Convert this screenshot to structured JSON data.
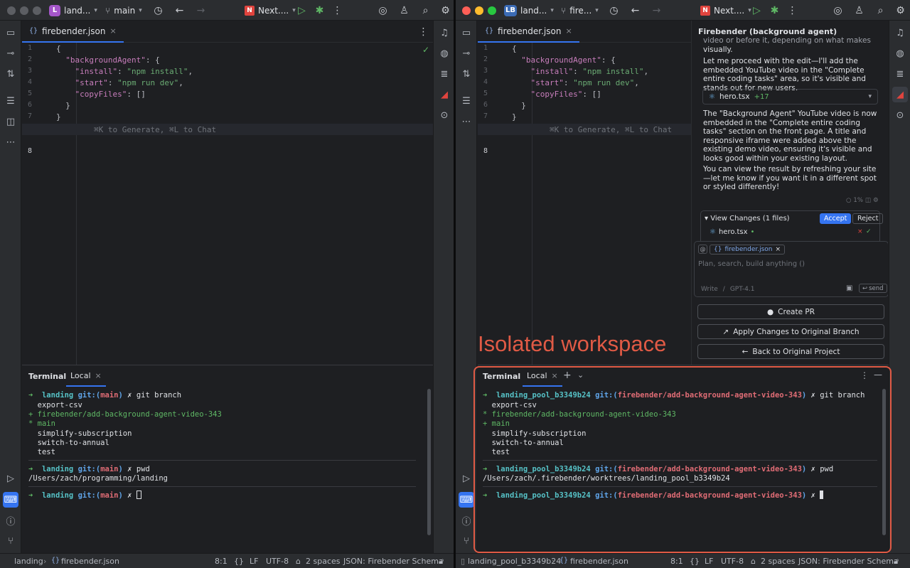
{
  "left": {
    "project": {
      "badge": "L",
      "name": "land...",
      "branch": "main",
      "badge_color": "#a456c9"
    },
    "run_config": "Next....",
    "editor": {
      "tab": "firebender.json"
    },
    "terminal": {
      "title": "Terminal",
      "tab": "Local",
      "lines": {
        "c1_dir": "landing",
        "c1_branch": "main",
        "c1_cmd": "git branch",
        "b1": "  export-csv",
        "b2": "+ firebender/add-background-agent-video-343",
        "b3": "* main",
        "b4": "  simplify-subscription",
        "b5": "  switch-to-annual",
        "b6": "  test",
        "c2_dir": "landing",
        "c2_branch": "main",
        "c2_cmd": "pwd",
        "pwd_out": "/Users/zach/programming/landing",
        "c3_dir": "landing",
        "c3_branch": "main"
      }
    },
    "status": {
      "breadcrumb_project": "landing",
      "breadcrumb_file": "firebender.json",
      "position": "8:1",
      "braces": "{}",
      "line_sep": "LF",
      "encoding": "UTF-8",
      "indent": "2 spaces",
      "schema": "JSON: Firebender Schema"
    }
  },
  "right": {
    "project": {
      "badge": "LB",
      "name": "land...",
      "branch": "fire...",
      "badge_color": "#3b6bb5"
    },
    "run_config": "Next....",
    "editor": {
      "tab": "firebender.json"
    },
    "agent": {
      "title": "Firebender (background agent)",
      "top_cut": "video or before it, depending on what makes sense",
      "p1_end": "visually.",
      "p2": "Let me proceed with the edit—I'll add the embedded YouTube video in the \"Complete entire coding tasks\" area, so it's visible and stands out for new users.",
      "chip_file": "hero.tsx",
      "chip_plus": "+17",
      "p3": "The \"Background Agent\" YouTube video is now embedded in the \"Complete entire coding tasks\" section on the front page. A title and responsive iframe were added above the existing demo video, ensuring it's visible and looks good within your existing layout.",
      "p4": "You can view the result by refreshing your site—let me know if you want it in a different spot or styled differently!",
      "usage": "1%",
      "changes_title": "View Changes (1 files)",
      "accept": "Accept",
      "reject": "Reject",
      "changed_file": "hero.tsx",
      "context_file": "firebender.json",
      "input_placeholder": "Plan, search, build anything ()",
      "mode": "Write",
      "mode_sep": "/",
      "model": "GPT-4.1",
      "send": "send",
      "create_pr": "Create PR",
      "apply_changes": "Apply Changes to Original Branch",
      "back": "Back to Original Project"
    },
    "annotation": "Isolated workspace",
    "terminal": {
      "title": "Terminal",
      "tab": "Local",
      "lines": {
        "c1_dir": "landing_pool_b3349b24",
        "c1_branch": "firebender/add-background-agent-video-343",
        "c1_cmd": "git branch",
        "b1": "  export-csv",
        "b2": "* firebender/add-background-agent-video-343",
        "b3": "+ main",
        "b4": "  simplify-subscription",
        "b5": "  switch-to-annual",
        "b6": "  test",
        "c2_dir": "landing_pool_b3349b24",
        "c2_branch": "firebender/add-background-agent-video-343",
        "c2_cmd": "pwd",
        "pwd_out": "/Users/zach/.firebender/worktrees/landing_pool_b3349b24",
        "c3_dir": "landing_pool_b3349b24",
        "c3_branch": "firebender/add-background-agent-video-343"
      }
    },
    "status": {
      "breadcrumb_project": "landing_pool_b3349b24",
      "breadcrumb_file": "firebender.json",
      "position": "8:1",
      "braces": "{}",
      "line_sep": "LF",
      "encoding": "UTF-8",
      "indent": "2 spaces",
      "schema": "JSON: Firebender Schema"
    }
  },
  "code": {
    "lines": [
      "1",
      "2",
      "3",
      "4",
      "5",
      "6",
      "7",
      "8"
    ],
    "l1": "{",
    "l2_key": "\"backgroundAgent\"",
    "l2_rest": ": {",
    "l3_key": "\"install\"",
    "l3_val": "\"npm install\"",
    "l4_key": "\"start\"",
    "l4_val": "\"npm run dev\"",
    "l5_key": "\"copyFiles\"",
    "l5_rest": ": []",
    "l6": "}",
    "l7": "}",
    "l8_hint": "⌘K to Generate, ⌘L to Chat"
  },
  "git_label": "git:",
  "colon": ",",
  "colon2": ":",
  "open_paren": "(",
  "close_paren": ")",
  "x_mark": "✗"
}
